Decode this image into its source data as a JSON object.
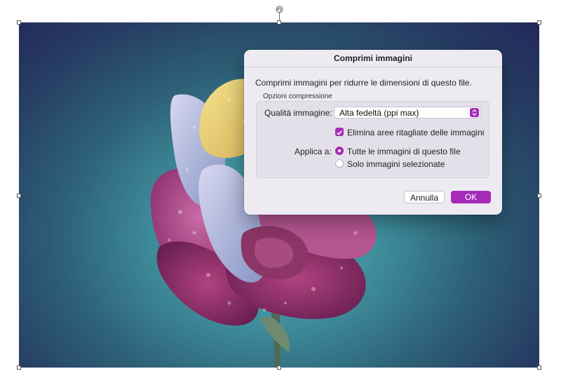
{
  "dialog": {
    "title": "Comprimi immagini",
    "description": "Comprimi immagini per ridurre le dimensioni di questo file.",
    "group_label": "Opzioni compressione",
    "quality": {
      "label": "Qualità immagine:",
      "value": "Alta fedeltà (ppi max)"
    },
    "crop_checkbox": {
      "label": "Elimina aree ritagliate delle immagini",
      "checked": true
    },
    "apply": {
      "label": "Applica a:",
      "options": [
        {
          "label": "Tutte le immagini di questo file",
          "selected": true
        },
        {
          "label": "Solo immagini selezionate",
          "selected": false
        }
      ]
    },
    "buttons": {
      "cancel": "Annulla",
      "ok": "OK"
    }
  },
  "icons": {
    "rotate": "rotate-handle-icon",
    "select_arrows": "chevron-up-down-icon",
    "check": "checkmark-icon"
  },
  "colors": {
    "accent": "#a52bb8",
    "dialog_bg": "#eeeaf2"
  }
}
